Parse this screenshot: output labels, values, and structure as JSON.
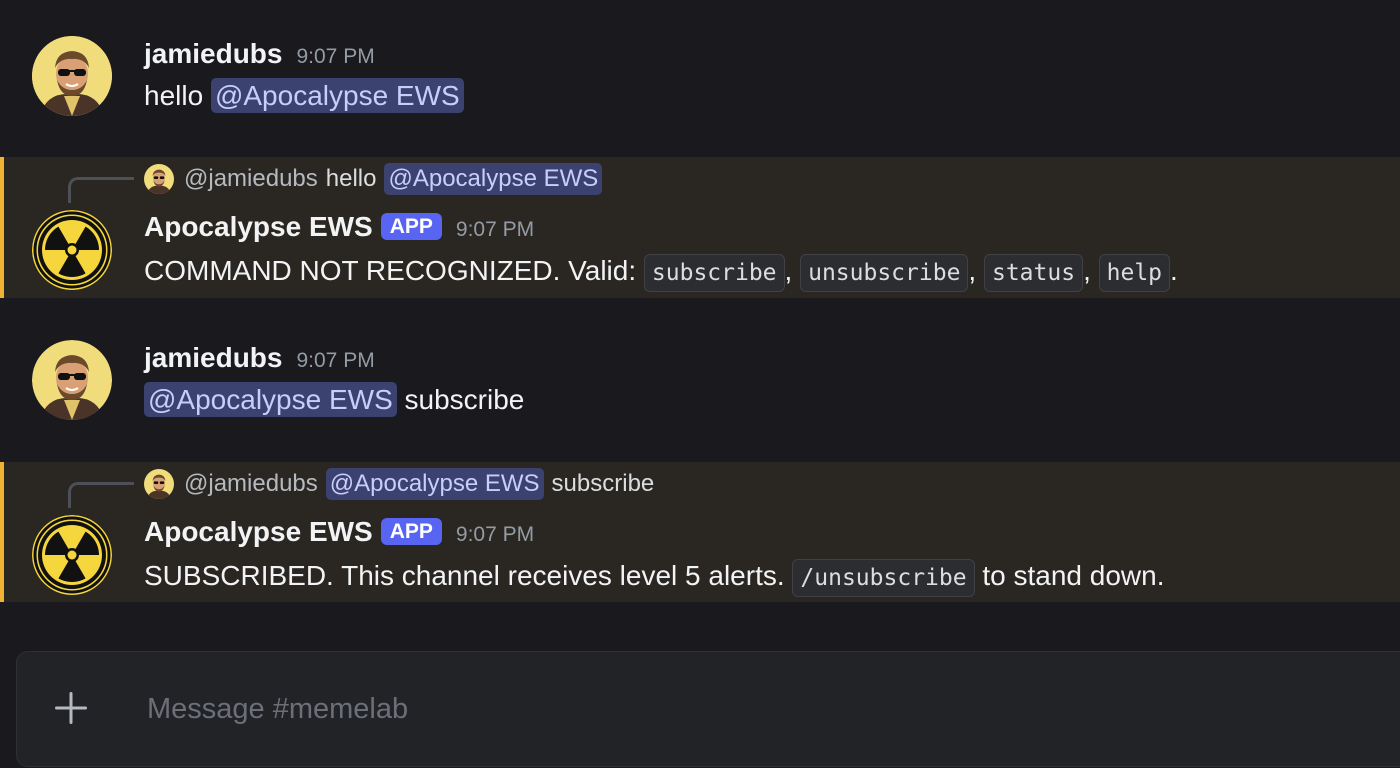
{
  "messages": [
    {
      "author": "jamiedubs",
      "time": "9:07 PM",
      "text_prefix": "hello",
      "mention": "@Apocalypse EWS"
    },
    {
      "reply": {
        "author": "@jamiedubs",
        "text": "hello",
        "mention": "@Apocalypse EWS"
      },
      "author": "Apocalypse EWS",
      "badge": "APP",
      "time": "9:07 PM",
      "text_prefix": "COMMAND NOT RECOGNIZED. Valid:",
      "commands": [
        "subscribe",
        "unsubscribe",
        "status",
        "help"
      ],
      "separator": ",",
      "terminal": "."
    },
    {
      "author": "jamiedubs",
      "time": "9:07 PM",
      "mention": "@Apocalypse EWS",
      "text_suffix": "subscribe"
    },
    {
      "reply": {
        "author": "@jamiedubs",
        "mention": "@Apocalypse EWS",
        "text": "subscribe"
      },
      "author": "Apocalypse EWS",
      "badge": "APP",
      "time": "9:07 PM",
      "text_prefix": "SUBSCRIBED. This channel receives level 5 alerts.",
      "command": "/unsubscribe",
      "text_suffix": "to stand down."
    }
  ],
  "composer": {
    "placeholder": "Message #memelab"
  },
  "colors": {
    "background": "#1a1a1e",
    "highlight_bg": "#2a2722",
    "highlight_border": "#f0b232",
    "mention_bg": "#3c4270",
    "mention_text": "#c9cdfb",
    "app_badge": "#5865f2",
    "hazard_yellow": "#f5d63d"
  }
}
